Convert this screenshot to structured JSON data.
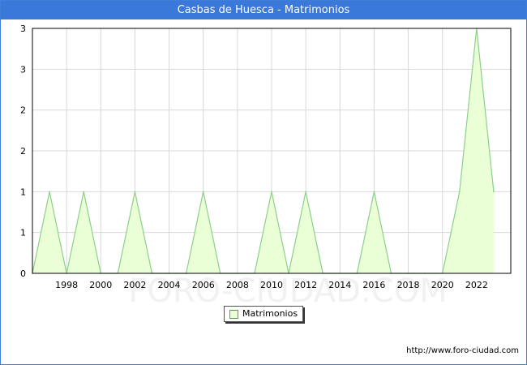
{
  "window": {
    "title": "Casbas de Huesca - Matrimonios"
  },
  "legend": {
    "label": "Matrimonios",
    "swatch_fill": "#eaffd6",
    "swatch_border": "#5a9a4a"
  },
  "source": "http://www.foro-ciudad.com",
  "watermark": "FORO-CIUDAD.COM",
  "chart_data": {
    "type": "area",
    "title": "Casbas de Huesca - Matrimonios",
    "xlabel": "",
    "ylabel": "",
    "series": [
      {
        "name": "Matrimonios",
        "x": [
          1996,
          1997,
          1998,
          1999,
          2000,
          2001,
          2002,
          2003,
          2004,
          2005,
          2006,
          2007,
          2008,
          2009,
          2010,
          2011,
          2012,
          2013,
          2014,
          2015,
          2016,
          2017,
          2018,
          2019,
          2020,
          2021,
          2022,
          2023
        ],
        "values": [
          0,
          1,
          0,
          1,
          0,
          0,
          1,
          0,
          0,
          0,
          1,
          0,
          0,
          0,
          1,
          0,
          1,
          0,
          0,
          0,
          1,
          0,
          0,
          0,
          0,
          1,
          3,
          1
        ]
      }
    ],
    "x_ticks": [
      "1998",
      "2000",
      "2002",
      "2004",
      "2006",
      "2008",
      "2010",
      "2012",
      "2014",
      "2016",
      "2018",
      "2020",
      "2022"
    ],
    "y_ticks": [
      "0",
      "1",
      "1",
      "2",
      "2",
      "3",
      "3"
    ],
    "xlim": [
      1996,
      2024
    ],
    "ylim": [
      0,
      3
    ],
    "grid": true,
    "legend_position": "bottom-center",
    "colors": {
      "fill": "#eaffd6",
      "line": "#8ccf8c",
      "grid": "#d8d8d8",
      "title_bar": "#3a78d9"
    }
  }
}
